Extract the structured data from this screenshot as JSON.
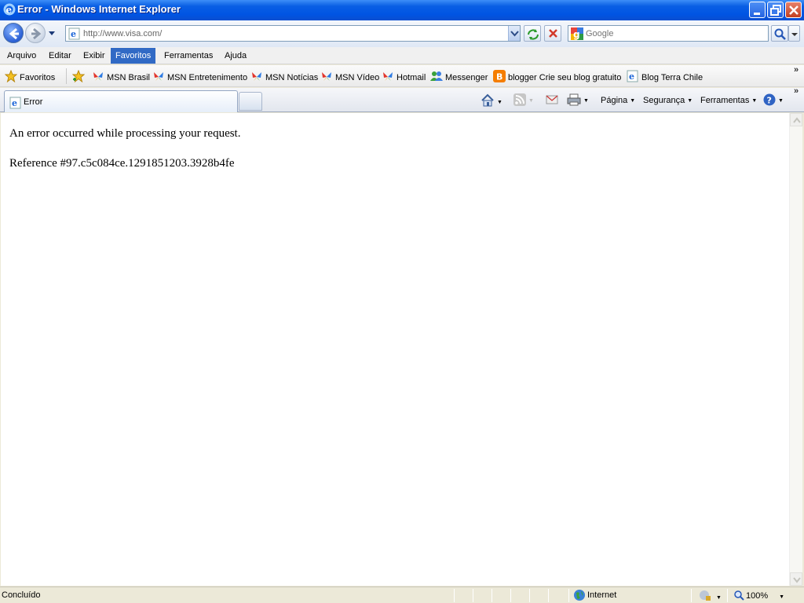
{
  "window": {
    "title": "Error - Windows Internet Explorer"
  },
  "navigation": {
    "address": "http://www.visa.com/",
    "search_placeholder": "Google"
  },
  "menu": [
    {
      "label": "Arquivo"
    },
    {
      "label": "Editar"
    },
    {
      "label": "Exibir"
    },
    {
      "label": "Favoritos"
    },
    {
      "label": "Ferramentas"
    },
    {
      "label": "Ajuda"
    }
  ],
  "favorites_bar": {
    "favorites_label": "Favoritos",
    "items": [
      {
        "label": "MSN Brasil",
        "icon": "msn-butterfly-icon"
      },
      {
        "label": "MSN Entretenimento",
        "icon": "msn-butterfly-icon"
      },
      {
        "label": "MSN Notícias",
        "icon": "msn-butterfly-icon"
      },
      {
        "label": "MSN Vídeo",
        "icon": "msn-butterfly-icon"
      },
      {
        "label": "Hotmail",
        "icon": "msn-butterfly-icon"
      },
      {
        "label": "Messenger",
        "icon": "messenger-icon"
      },
      {
        "label": "blogger Crie seu blog gratuito",
        "icon": "blogger-icon"
      },
      {
        "label": "Blog Terra Chile",
        "icon": "ie-page-icon"
      }
    ]
  },
  "tabs": {
    "active_tab": "Error"
  },
  "command_bar": {
    "pagina": "Página",
    "seguranca": "Segurança",
    "ferramentas": "Ferramentas"
  },
  "page": {
    "line1": "An error occurred while processing your request.",
    "line2": "Reference #97.c5c084ce.1291851203.3928b4fe"
  },
  "status_bar": {
    "status": "Concluído",
    "zone": "Internet",
    "zoom": "100%"
  },
  "colors": {
    "titlebar": "#0054e3",
    "menu_active": "#316ac5"
  }
}
